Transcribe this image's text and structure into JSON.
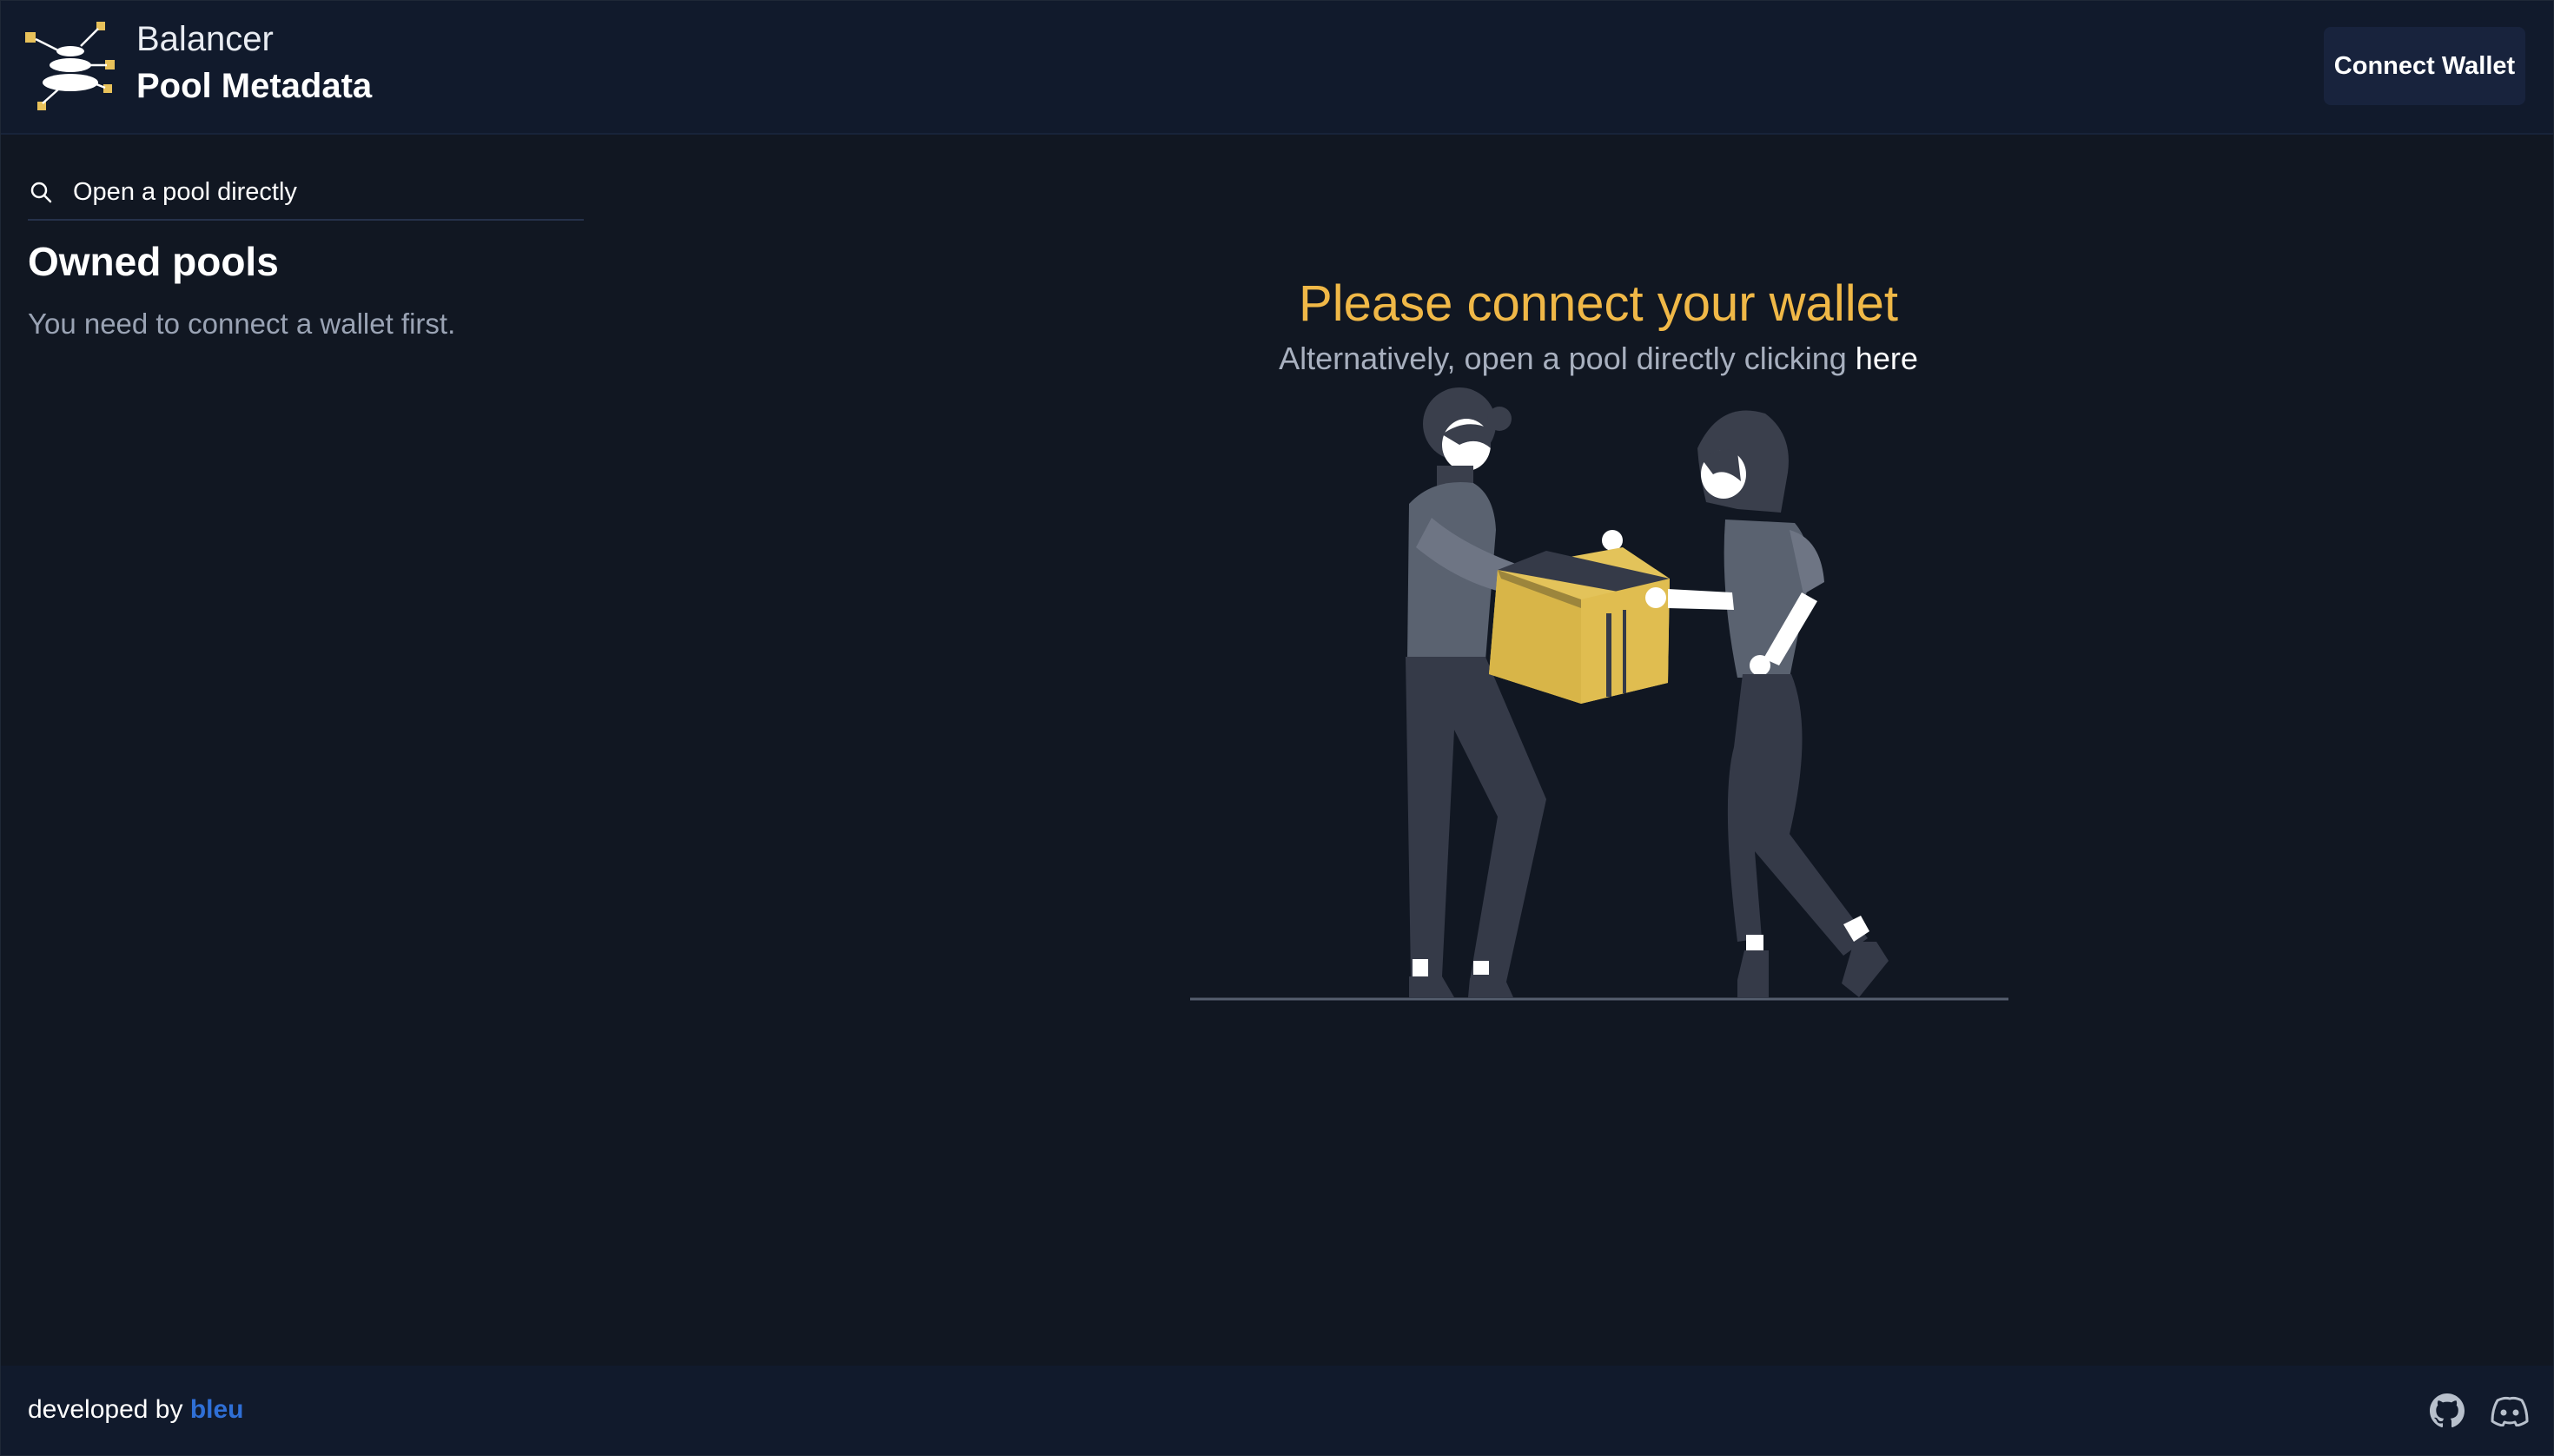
{
  "header": {
    "brand": "Balancer",
    "title": "Pool Metadata",
    "connect_label": "Connect Wallet",
    "logo_icon": "balancer-logo-icon"
  },
  "sidebar": {
    "search_placeholder": "Open a pool directly",
    "owned_title": "Owned pools",
    "owned_message": "You need to connect a wallet first."
  },
  "main": {
    "heading": "Please connect your wallet",
    "subtext": "Alternatively, open a pool directly clicking ",
    "link_text": "here",
    "illustration": "people-handing-box-illustration"
  },
  "footer": {
    "developed_by": "developed by ",
    "developer": "bleu",
    "icons": [
      "github-icon",
      "discord-icon"
    ]
  },
  "colors": {
    "background": "#111722",
    "header_bg": "#111a2c",
    "accent": "#f0b847",
    "link_blue": "#2f6fd6",
    "muted_text": "#9aa3b4"
  }
}
